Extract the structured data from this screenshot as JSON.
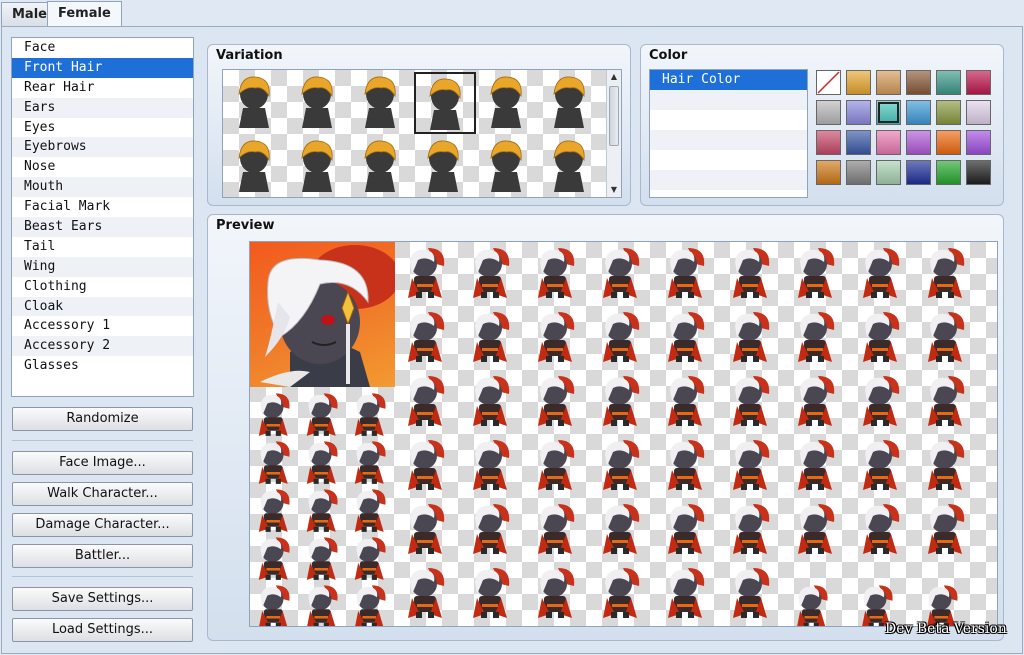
{
  "tabs": [
    {
      "label": "Male",
      "active": false
    },
    {
      "label": "Female",
      "active": true
    }
  ],
  "parts": {
    "selected_index": 1,
    "items": [
      "Face",
      "Front Hair",
      "Rear Hair",
      "Ears",
      "Eyes",
      "Eyebrows",
      "Nose",
      "Mouth",
      "Facial Mark",
      "Beast Ears",
      "Tail",
      "Wing",
      "Clothing",
      "Cloak",
      "Accessory 1",
      "Accessory 2",
      "Glasses"
    ]
  },
  "buttons": {
    "randomize": "Randomize",
    "face_image": "Face Image...",
    "walk_character": "Walk Character...",
    "damage_character": "Damage Character...",
    "battler": "Battler...",
    "save_settings": "Save Settings...",
    "load_settings": "Load Settings..."
  },
  "variation": {
    "title": "Variation",
    "selected_index": 3,
    "hair_color": "#e8a62a"
  },
  "color": {
    "title": "Color",
    "list": [
      "Hair Color"
    ],
    "selected_index": 0,
    "selected_swatch": 8,
    "swatches": [
      "none",
      "#e6a630",
      "#d49a5a",
      "#8a5a3a",
      "#3d9a8a",
      "#c01850",
      "#b8b8b8",
      "#8c8ae0",
      "#4cc8c0",
      "#3f9ad8",
      "#8a9a40",
      "#e0d0e8",
      "#c84a6a",
      "#3a5aa8",
      "#e87ab0",
      "#b05ad8",
      "#f06a10",
      "#a050e0",
      "#d07a1a",
      "#808080",
      "#a8d0b0",
      "#20309a",
      "#28a830",
      "#202020"
    ]
  },
  "preview": {
    "title": "Preview",
    "portrait_label": "face-portrait"
  },
  "watermark": "Dev Beta Version"
}
